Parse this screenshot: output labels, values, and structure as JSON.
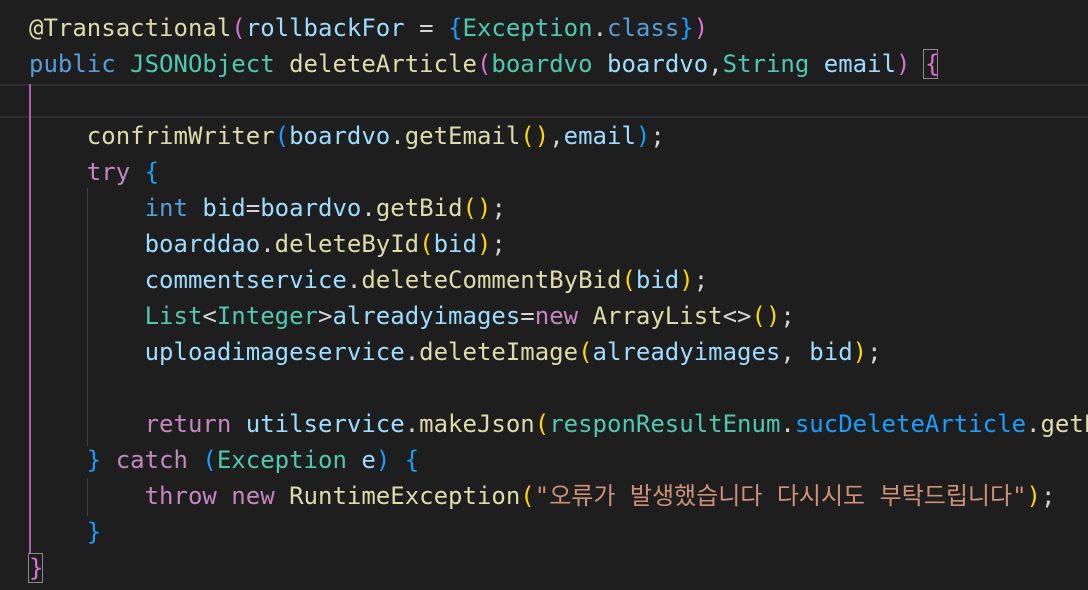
{
  "colors": {
    "background": "#1e1e1e",
    "default": "#d4d4d4",
    "keyword": "#569cd6",
    "control": "#c586c0",
    "type": "#4ec9b0",
    "function": "#dcdcaa",
    "variable": "#9cdcfe",
    "string": "#ce9178",
    "bracket1": "#ffd700",
    "bracket2": "#da70d6",
    "bracket3": "#179fff",
    "annotation": "#dcdcaa"
  },
  "lines": [
    {
      "tokens": [
        [
          "@Transactional",
          "annotation"
        ],
        [
          "(",
          "bracket2"
        ],
        [
          "rollbackFor",
          "variable"
        ],
        [
          " = ",
          "default"
        ],
        [
          "{",
          "bracket3"
        ],
        [
          "Exception",
          "type"
        ],
        [
          ".",
          "default"
        ],
        [
          "class",
          "keyword"
        ],
        [
          "}",
          "bracket3"
        ],
        [
          ")",
          "bracket2"
        ]
      ]
    },
    {
      "tokens": [
        [
          "public",
          "keyword"
        ],
        [
          " ",
          "default"
        ],
        [
          "JSONObject",
          "type"
        ],
        [
          " ",
          "default"
        ],
        [
          "deleteArticle",
          "function"
        ],
        [
          "(",
          "bracket2"
        ],
        [
          "boardvo",
          "type"
        ],
        [
          " ",
          "default"
        ],
        [
          "boardvo",
          "variable"
        ],
        [
          ",",
          "default"
        ],
        [
          "String",
          "type"
        ],
        [
          " ",
          "default"
        ],
        [
          "email",
          "variable"
        ],
        [
          ")",
          "bracket2"
        ],
        [
          " ",
          "default"
        ],
        [
          "{",
          "bracket2"
        ]
      ]
    },
    {
      "tokens": []
    },
    {
      "tokens": [
        [
          "    ",
          "default"
        ],
        [
          "confrimWriter",
          "function"
        ],
        [
          "(",
          "bracket3"
        ],
        [
          "boardvo",
          "variable"
        ],
        [
          ".",
          "default"
        ],
        [
          "getEmail",
          "function"
        ],
        [
          "()",
          "bracket1"
        ],
        [
          ",",
          "default"
        ],
        [
          "email",
          "variable"
        ],
        [
          ")",
          "bracket3"
        ],
        [
          ";",
          "default"
        ]
      ]
    },
    {
      "tokens": [
        [
          "    ",
          "default"
        ],
        [
          "try",
          "control"
        ],
        [
          " ",
          "default"
        ],
        [
          "{",
          "bracket3"
        ]
      ]
    },
    {
      "tokens": [
        [
          "        ",
          "default"
        ],
        [
          "int",
          "keyword"
        ],
        [
          " ",
          "default"
        ],
        [
          "bid",
          "variable"
        ],
        [
          "=",
          "default"
        ],
        [
          "boardvo",
          "variable"
        ],
        [
          ".",
          "default"
        ],
        [
          "getBid",
          "function"
        ],
        [
          "()",
          "bracket1"
        ],
        [
          ";",
          "default"
        ]
      ]
    },
    {
      "tokens": [
        [
          "        ",
          "default"
        ],
        [
          "boarddao",
          "variable"
        ],
        [
          ".",
          "default"
        ],
        [
          "deleteById",
          "function"
        ],
        [
          "(",
          "bracket1"
        ],
        [
          "bid",
          "variable"
        ],
        [
          ")",
          "bracket1"
        ],
        [
          ";",
          "default"
        ]
      ]
    },
    {
      "tokens": [
        [
          "        ",
          "default"
        ],
        [
          "commentservice",
          "variable"
        ],
        [
          ".",
          "default"
        ],
        [
          "deleteCommentByBid",
          "function"
        ],
        [
          "(",
          "bracket1"
        ],
        [
          "bid",
          "variable"
        ],
        [
          ")",
          "bracket1"
        ],
        [
          ";",
          "default"
        ]
      ]
    },
    {
      "tokens": [
        [
          "        ",
          "default"
        ],
        [
          "List",
          "type"
        ],
        [
          "<",
          "default"
        ],
        [
          "Integer",
          "type"
        ],
        [
          ">",
          "default"
        ],
        [
          "alreadyimages",
          "variable"
        ],
        [
          "=",
          "default"
        ],
        [
          "new",
          "control"
        ],
        [
          " ",
          "default"
        ],
        [
          "ArrayList",
          "function"
        ],
        [
          "<>",
          "default"
        ],
        [
          "()",
          "bracket1"
        ],
        [
          ";",
          "default"
        ]
      ]
    },
    {
      "tokens": [
        [
          "        ",
          "default"
        ],
        [
          "uploadimageservice",
          "variable"
        ],
        [
          ".",
          "default"
        ],
        [
          "deleteImage",
          "function"
        ],
        [
          "(",
          "bracket1"
        ],
        [
          "alreadyimages",
          "variable"
        ],
        [
          ", ",
          "default"
        ],
        [
          "bid",
          "variable"
        ],
        [
          ")",
          "bracket1"
        ],
        [
          ";",
          "default"
        ]
      ]
    },
    {
      "tokens": []
    },
    {
      "tokens": [
        [
          "        ",
          "default"
        ],
        [
          "return",
          "control"
        ],
        [
          " ",
          "default"
        ],
        [
          "utilservice",
          "variable"
        ],
        [
          ".",
          "default"
        ],
        [
          "makeJson",
          "function"
        ],
        [
          "(",
          "bracket1"
        ],
        [
          "responResultEnum",
          "type"
        ],
        [
          ".",
          "default"
        ],
        [
          "sucDeleteArticle",
          "bracket3"
        ],
        [
          ".",
          "default"
        ],
        [
          "getE",
          "function"
        ]
      ]
    },
    {
      "tokens": [
        [
          "    ",
          "default"
        ],
        [
          "}",
          "bracket3"
        ],
        [
          " ",
          "default"
        ],
        [
          "catch",
          "control"
        ],
        [
          " ",
          "default"
        ],
        [
          "(",
          "bracket3"
        ],
        [
          "Exception",
          "type"
        ],
        [
          " ",
          "default"
        ],
        [
          "e",
          "variable"
        ],
        [
          ")",
          "bracket3"
        ],
        [
          " ",
          "default"
        ],
        [
          "{",
          "bracket3"
        ]
      ]
    },
    {
      "tokens": [
        [
          "        ",
          "default"
        ],
        [
          "throw",
          "control"
        ],
        [
          " ",
          "default"
        ],
        [
          "new",
          "control"
        ],
        [
          " ",
          "default"
        ],
        [
          "RuntimeException",
          "function"
        ],
        [
          "(",
          "bracket1"
        ],
        [
          "\"오류가 발생했습니다 다시시도 부탁드립니다\"",
          "string"
        ],
        [
          ")",
          "bracket1"
        ],
        [
          ";",
          "default"
        ]
      ]
    },
    {
      "tokens": [
        [
          "    ",
          "default"
        ],
        [
          "}",
          "bracket3"
        ]
      ]
    },
    {
      "tokens": [
        [
          "}",
          "bracket2"
        ]
      ]
    }
  ]
}
